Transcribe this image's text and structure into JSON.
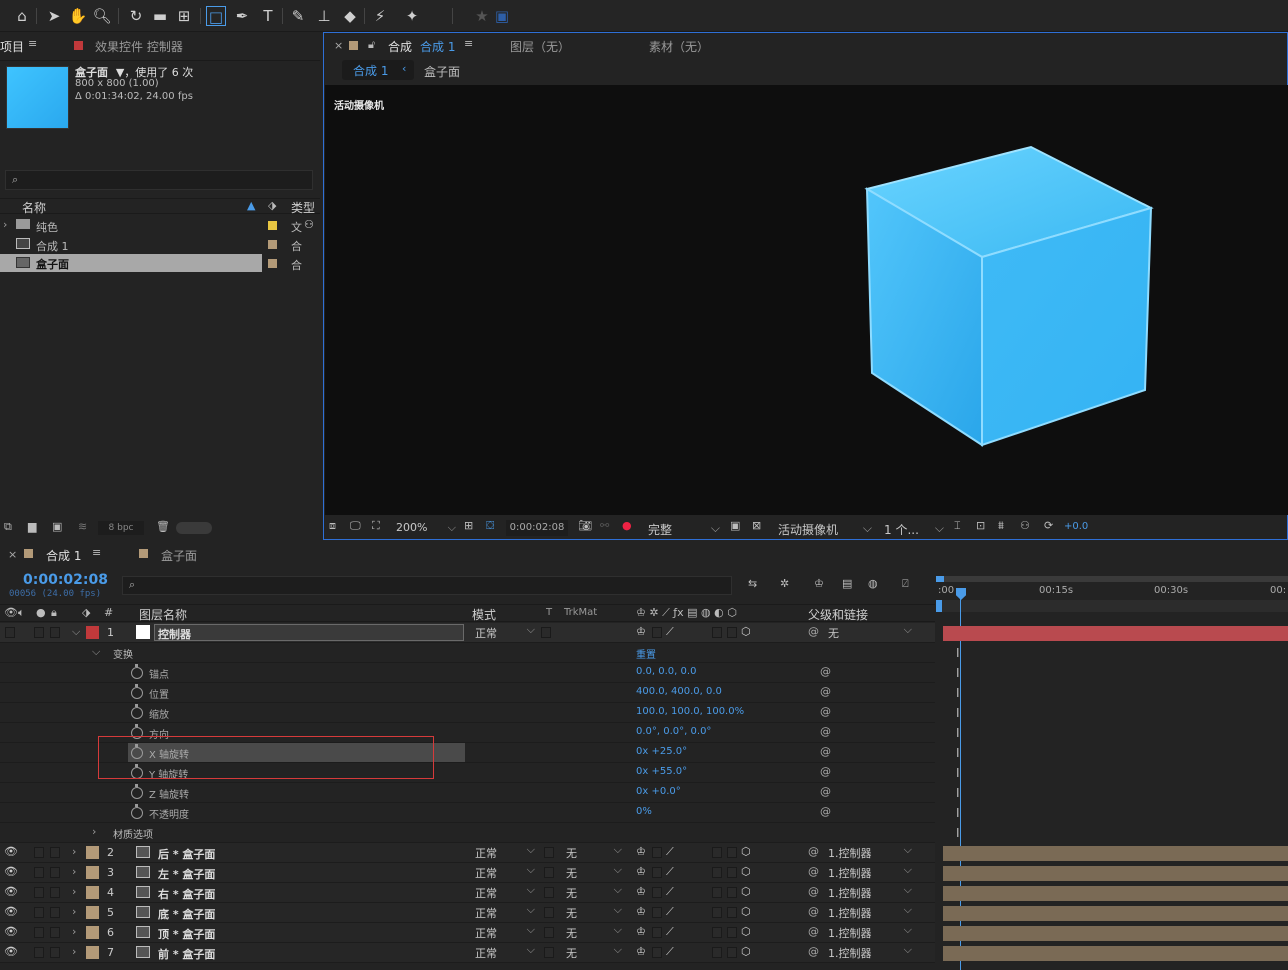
{
  "project_panel": {
    "tab_project": "项目",
    "tab_effects": "效果控件 控制器",
    "item_name": "盒子面",
    "item_usage": "，使用了 6 次",
    "item_size": "800 x 800 (1.00)",
    "item_duration": "Δ 0:01:34:02, 24.00 fps",
    "col_name": "名称",
    "col_type": "类型",
    "items": [
      {
        "name": "纯色",
        "type": "文"
      },
      {
        "name": "合成 1",
        "type": "合"
      },
      {
        "name": "盒子面",
        "type": "合"
      }
    ],
    "bpc": "8 bpc"
  },
  "viewer_panel": {
    "tab_comp_label": "合成",
    "tab_comp_name": "合成 1",
    "tab_layer": "图层（无）",
    "tab_footage": "素材（无）",
    "breadcrumb_1": "合成 1",
    "breadcrumb_2": "盒子面",
    "camera_label": "活动摄像机",
    "zoom": "200%",
    "timecode": "0:00:02:08",
    "resolution": "完整",
    "camera": "活动摄像机",
    "views": "1 个...",
    "exposure": "+0.0"
  },
  "timeline": {
    "tab_comp": "合成 1",
    "tab_box": "盒子面",
    "timecode": "0:00:02:08",
    "frame_info": "00056 (24.00 fps)",
    "col_layer_name": "图层名称",
    "col_mode": "模式",
    "col_t": "T",
    "col_trkmat": "TrkMat",
    "col_parent": "父级和链接",
    "ruler": [
      "00:15s",
      "00:30s"
    ],
    "ruler_start": ":00",
    "layer1": {
      "num": "1",
      "name": "控制器",
      "mode": "正常",
      "parent": "无"
    },
    "transform_label": "变换",
    "reset_label": "重置",
    "properties": [
      {
        "name": "锚点",
        "value": "0.0, 0.0, 0.0"
      },
      {
        "name": "位置",
        "value": "400.0, 400.0, 0.0"
      },
      {
        "name": "缩放",
        "value": "100.0, 100.0, 100.0%"
      },
      {
        "name": "方向",
        "value": "0.0°, 0.0°, 0.0°"
      },
      {
        "name": "X 轴旋转",
        "value": "0x +25.0°"
      },
      {
        "name": "Y 轴旋转",
        "value": "0x +55.0°"
      },
      {
        "name": "Z 轴旋转",
        "value": "0x +0.0°"
      },
      {
        "name": "不透明度",
        "value": "0%"
      }
    ],
    "material_label": "材质选项",
    "layers": [
      {
        "num": "2",
        "name": "后 * 盒子面",
        "mode": "正常",
        "trkmat": "无",
        "parent": "1.控制器"
      },
      {
        "num": "3",
        "name": "左 * 盒子面",
        "mode": "正常",
        "trkmat": "无",
        "parent": "1.控制器"
      },
      {
        "num": "4",
        "name": "右 * 盒子面",
        "mode": "正常",
        "trkmat": "无",
        "parent": "1.控制器"
      },
      {
        "num": "5",
        "name": "底 * 盒子面",
        "mode": "正常",
        "trkmat": "无",
        "parent": "1.控制器"
      },
      {
        "num": "6",
        "name": "顶 * 盒子面",
        "mode": "正常",
        "trkmat": "无",
        "parent": "1.控制器"
      },
      {
        "num": "7",
        "name": "前 * 盒子面",
        "mode": "正常",
        "trkmat": "无",
        "parent": "1.控制器"
      }
    ]
  },
  "colors": {
    "accent_blue": "#4a9be8",
    "cube": "#3cbcf5",
    "controller_label": "#c0393b",
    "layer_label": "#b39a78",
    "highlight_box": "#d63a3a"
  }
}
